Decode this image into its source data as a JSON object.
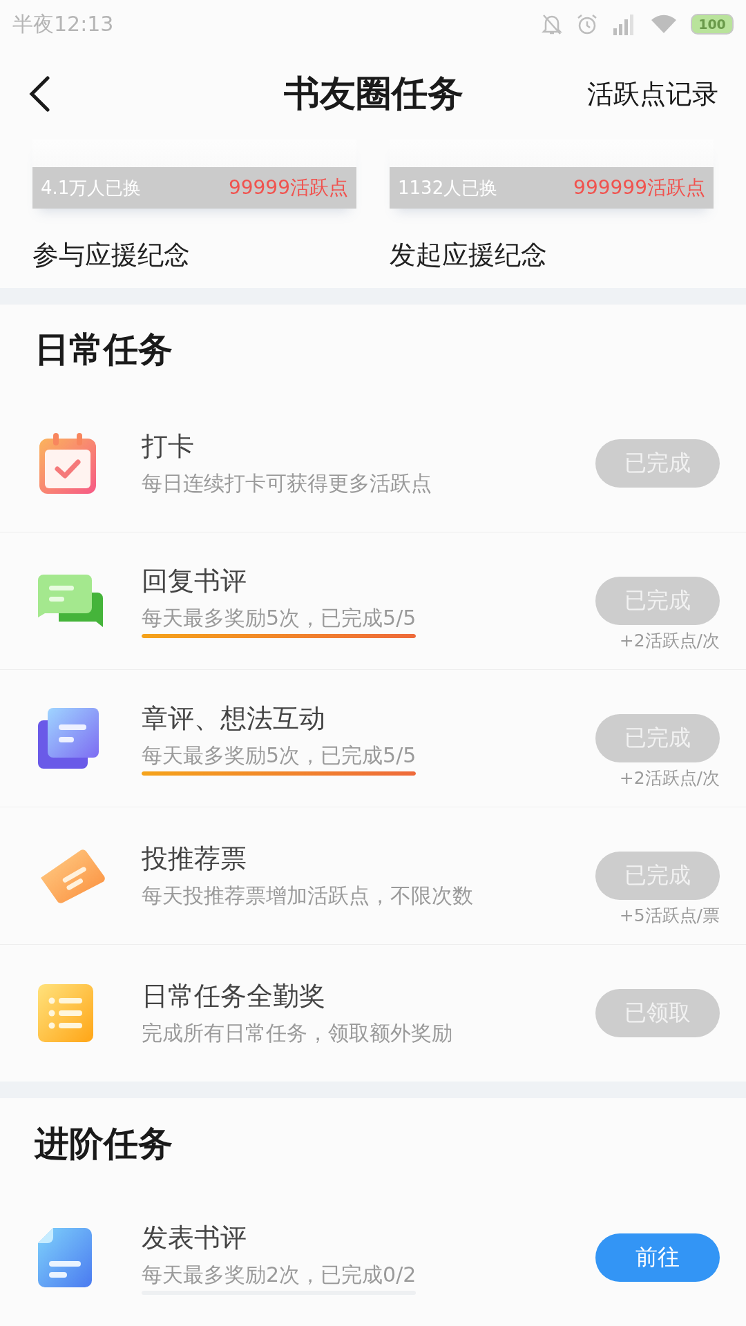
{
  "status_bar": {
    "time": "半夜12:13",
    "battery": "100"
  },
  "header": {
    "title": "书友圈任务",
    "action": "活跃点记录"
  },
  "rewards": [
    {
      "count": "4.1万人已换",
      "price": "99999活跃点",
      "name": "参与应援纪念"
    },
    {
      "count": "1132人已换",
      "price": "999999活跃点",
      "name": "发起应援纪念"
    }
  ],
  "sections": [
    {
      "title": "日常任务",
      "tasks": [
        {
          "kind": "calendar",
          "title": "打卡",
          "description": "每日连续打卡可获得更多活跃点",
          "button": "已完成",
          "done": true
        },
        {
          "kind": "chat",
          "title": "回复书评",
          "description": "每天最多奖励5次，已完成5/5",
          "level": 1,
          "button": "已完成",
          "done": true,
          "reward": "+2活跃点/次"
        },
        {
          "kind": "cards",
          "title": "章评、想法互动",
          "description": "每天最多奖励5次，已完成5/5",
          "level": 1,
          "button": "已完成",
          "done": true,
          "reward": "+2活跃点/次"
        },
        {
          "kind": "ticket",
          "title": "投推荐票",
          "description": "每天投推荐票增加活跃点，不限次数",
          "button": "已完成",
          "done": true,
          "reward": "+5活跃点/票"
        },
        {
          "kind": "list",
          "title": "日常任务全勤奖",
          "description": "完成所有日常任务，领取额外奖励",
          "button": "已领取",
          "done": true
        }
      ]
    },
    {
      "title": "进阶任务",
      "tasks": [
        {
          "kind": "document",
          "title": "发表书评",
          "description": "每天最多奖励2次，已完成0/2",
          "level": 0,
          "button": "前往",
          "done": false
        }
      ]
    }
  ]
}
